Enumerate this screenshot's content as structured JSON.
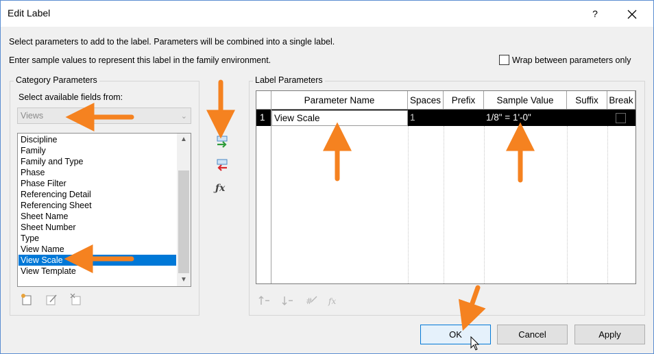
{
  "window": {
    "title": "Edit Label",
    "help_label": "?"
  },
  "instructions": {
    "line1": "Select parameters to add to the label.  Parameters will be combined into a single label.",
    "line2": "Enter sample values to represent this label in the family environment."
  },
  "wrap_option": {
    "label": "Wrap between parameters only",
    "checked": false
  },
  "category": {
    "group_label": "Category Parameters",
    "select_label": "Select available fields from:",
    "selected_category": "Views",
    "fields": [
      "Discipline",
      "Family",
      "Family and Type",
      "Phase",
      "Phase Filter",
      "Referencing Detail",
      "Referencing Sheet",
      "Sheet Name",
      "Sheet Number",
      "Type",
      "View Name",
      "View Scale",
      "View Template"
    ],
    "selected_field": "View Scale"
  },
  "middle_icons": [
    "add-parameter-icon",
    "remove-parameter-icon",
    "function-icon"
  ],
  "label_params": {
    "group_label": "Label Parameters",
    "columns": {
      "parameter_name": "Parameter Name",
      "spaces": "Spaces",
      "prefix": "Prefix",
      "sample_value": "Sample Value",
      "suffix": "Suffix",
      "break": "Break"
    },
    "rows": [
      {
        "index": "1",
        "parameter_name": "View Scale",
        "spaces": "1",
        "prefix": "",
        "sample_value": "1/8\" = 1'-0\"",
        "suffix": "",
        "break": false
      }
    ]
  },
  "grid_icons": [
    "move-up-icon",
    "move-down-icon",
    "edit-units-icon",
    "formula-icon"
  ],
  "buttons": {
    "ok": "OK",
    "cancel": "Cancel",
    "apply": "Apply"
  },
  "colors": {
    "selection": "#0078d7",
    "annotation_arrow": "#f58220",
    "ok_border": "#0078d7"
  }
}
